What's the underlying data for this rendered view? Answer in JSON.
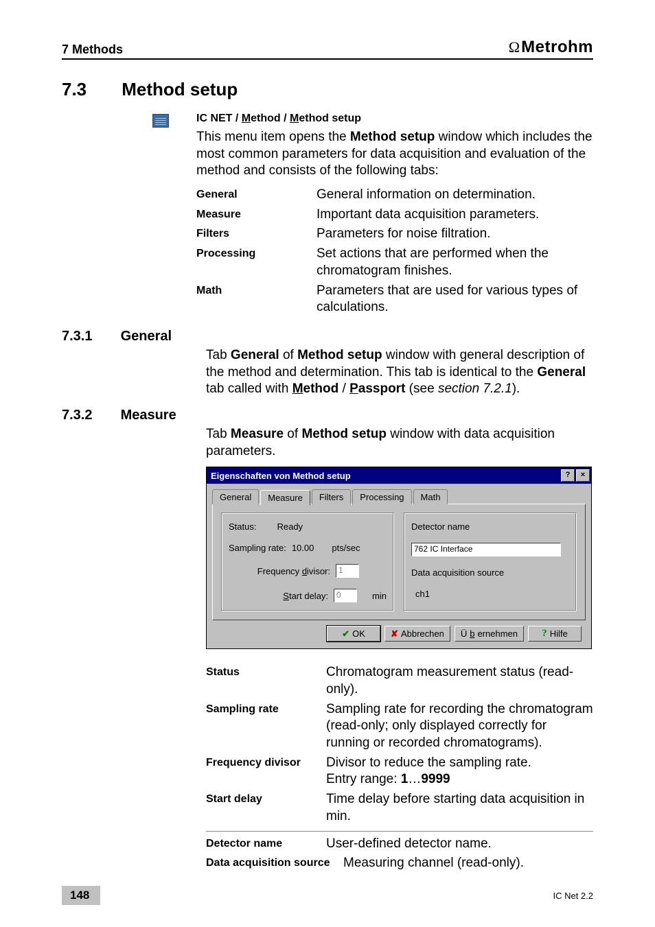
{
  "header": {
    "chapter": "7 Methods",
    "brand_symbol": "Ω",
    "brand_name": "Metrohm"
  },
  "section": {
    "number": "7.3",
    "title": "Method setup"
  },
  "menu_path": {
    "app": "IC NET",
    "sep": " / ",
    "lvl1_u": "M",
    "lvl1_rest": "ethod",
    "lvl2_u": "M",
    "lvl2_rest": "ethod setup"
  },
  "intro": {
    "p1a": "This menu item opens the ",
    "p1b": "Method setup",
    "p1c": " window which includes the most common parameters for data acquisition and evaluation of the method and consists of the following tabs:"
  },
  "tabs_desc": [
    {
      "term": "General",
      "desc": "General information on determination."
    },
    {
      "term": "Measure",
      "desc": "Important data acquisition parameters."
    },
    {
      "term": "Filters",
      "desc": "Parameters for noise filtration."
    },
    {
      "term": "Processing",
      "desc": "Set actions that are performed when the chromatogram finishes."
    },
    {
      "term": "Math",
      "desc": "Parameters that are used for various types of calculations."
    }
  ],
  "sub1": {
    "number": "7.3.1",
    "title": "General"
  },
  "sub1_text": {
    "a": "Tab ",
    "b": "General",
    "c": " of ",
    "d": "Method setup",
    "e": " window with general description of the method and determination. This tab is identical to the ",
    "f": "General",
    "g": " tab called with ",
    "mp1_u": "M",
    "mp1_r": "ethod",
    "mp2_u": "P",
    "mp2_r": "assport",
    "h": " (see ",
    "i": "section 7.2.1",
    "j": ")."
  },
  "sub2": {
    "number": "7.3.2",
    "title": "Measure"
  },
  "sub2_text": {
    "a": "Tab ",
    "b": "Measure",
    "c": " of ",
    "d": "Method setup",
    "e": " window with data acquisition parameters."
  },
  "dialog": {
    "title": "Eigenschaften von Method setup",
    "help_glyph": "?",
    "close_glyph": "×",
    "tabs": {
      "general": "General",
      "measure": "Measure",
      "filters": "Filters",
      "processing": "Processing",
      "math": "Math"
    },
    "left": {
      "status_label": "Status:",
      "status_value": "Ready",
      "sampling_label": "Sampling rate:",
      "sampling_value": "10.00",
      "sampling_unit": "pts/sec",
      "freq_pre": "Frequency ",
      "freq_u": "d",
      "freq_post": "ivisor:",
      "freq_value": "1",
      "delay_u": "S",
      "delay_post": "tart delay:",
      "delay_value": "0",
      "delay_unit": "min"
    },
    "right": {
      "det_label": "Detector name",
      "det_value": "762 IC Interface",
      "src_label": "Data acquisition source",
      "src_value": "ch1"
    },
    "buttons": {
      "ok": "OK",
      "cancel": "Abbrechen",
      "apply_pre": "Ü",
      "apply_u": "b",
      "apply_post": "ernehmen",
      "help": "Hilfe"
    }
  },
  "params": [
    {
      "term": "Status",
      "desc": "Chromatogram measurement status (read-only)."
    },
    {
      "term": "Sampling rate",
      "desc": "Sampling rate for recording the chromatogram (read-only; only displayed correctly for running or recorded chromatograms)."
    }
  ],
  "freq_row": {
    "term": "Frequency divisor",
    "desc_a": "Divisor to reduce the sampling rate.",
    "desc_b_pre": "Entry range:  ",
    "desc_b_bold1": "1",
    "desc_b_mid": "…",
    "desc_b_bold2": "9999"
  },
  "params2": [
    {
      "term": "Start delay",
      "desc": "Time delay before starting data acquisition in min."
    }
  ],
  "params3": [
    {
      "term": "Detector name",
      "desc": "User-defined detector name."
    },
    {
      "term": "Data acquisition source",
      "desc": "Measuring channel (read-only)."
    }
  ],
  "footer": {
    "page": "148",
    "product": "IC Net 2.2"
  }
}
